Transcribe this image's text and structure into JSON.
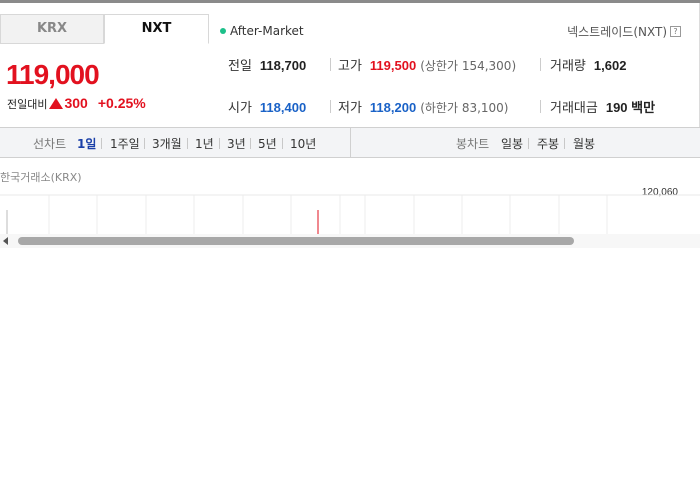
{
  "exchange_tabs": [
    {
      "label": "KRX",
      "selected": false
    },
    {
      "label": "NXT",
      "selected": true
    }
  ],
  "session_status": "After-Market",
  "nxt_link": "넥스트레이드(NXT)",
  "help_icon": "?",
  "price": {
    "current": "119,000",
    "change_label": "전일대비",
    "change_value": "300",
    "change_percent": "+0.25%",
    "direction": "up"
  },
  "stats": {
    "prev_close": {
      "label": "전일",
      "value": "118,700"
    },
    "high": {
      "label": "고가",
      "value": "119,500",
      "sub": "(상한가 154,300)"
    },
    "volume": {
      "label": "거래량",
      "value": "1,602"
    },
    "open": {
      "label": "시가",
      "value": "118,400"
    },
    "low": {
      "label": "저가",
      "value": "118,200",
      "sub": "(하한가 83,100)"
    },
    "trade_value": {
      "label": "거래대금",
      "value": "190 백만"
    }
  },
  "line_chart": {
    "label": "선차트",
    "periods": [
      "1일",
      "1주일",
      "3개월",
      "1년",
      "3년",
      "5년",
      "10년"
    ],
    "selected": "1일"
  },
  "candle_chart": {
    "label": "봉차트",
    "periods": [
      "일봉",
      "주봉",
      "월봉"
    ]
  },
  "chart_source": "한국거래소(KRX)",
  "chart_y_tick": "120,060",
  "colors": {
    "up": "#e2111f",
    "down": "#1a62c7",
    "active": "#1a3fa8",
    "dot": "#1cc08a"
  }
}
